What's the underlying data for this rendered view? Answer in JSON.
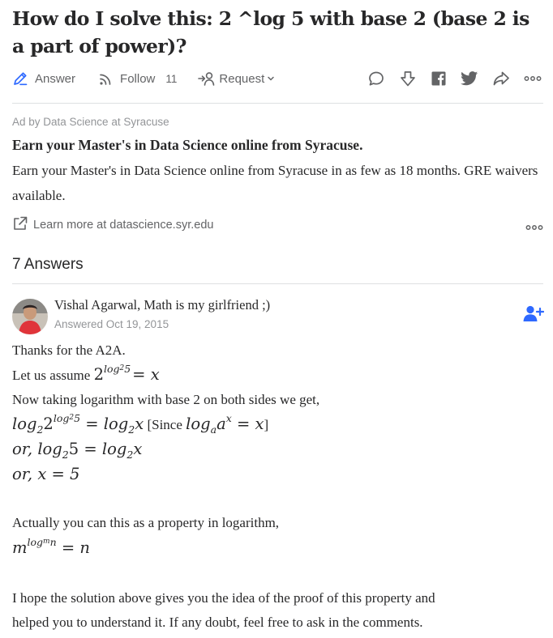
{
  "question": {
    "title": "How do I solve this: 2 ^log 5 with base 2 (base 2 is a part of power)?"
  },
  "actions": {
    "answer_label": "Answer",
    "follow_label": "Follow",
    "follow_count": "11",
    "request_label": "Request",
    "answer_icon": "pencil-icon",
    "follow_icon": "rss-follow-icon",
    "request_icon": "person-arrow-icon",
    "right_icons": [
      "comment-icon",
      "downvote-icon",
      "facebook-icon",
      "twitter-icon",
      "share-icon",
      "more-icon"
    ]
  },
  "ad": {
    "label": "Ad by Data Science at Syracuse",
    "headline": "Earn your Master's in Data Science online from Syracuse.",
    "body": "Earn your Master's in Data Science online from Syracuse in as few as 18 months. GRE waivers available.",
    "link_text": "Learn more at datascience.syr.edu",
    "link_icon": "external-link-icon"
  },
  "answers_header": "7 Answers",
  "answer": {
    "author_line": "Vishal Agarwal, Math is my girlfriend ;)",
    "answered": "Answered Oct 19, 2015",
    "follow_icon": "add-user-icon",
    "lines": {
      "l1": "Thanks for the A2A.",
      "l2_text": "Let us assume ",
      "l3": "Now taking logarithm with base 2 on both sides we get,",
      "l4_since": " [Since ",
      "l4_close": "]",
      "l5_prefix": "or, ",
      "l6": "or, x = 5",
      "l7": "Actually you can this as a property in logarithm,",
      "l8": "I hope the solution above gives you the idea of the proof of this property and",
      "l9": "helped you to understand it. If any doubt, feel free to ask in the comments."
    }
  },
  "colors": {
    "text": "#282829",
    "muted": "#636466",
    "light": "#939598",
    "accent_blue": "#2e69ff",
    "divider": "#dee0e1"
  }
}
